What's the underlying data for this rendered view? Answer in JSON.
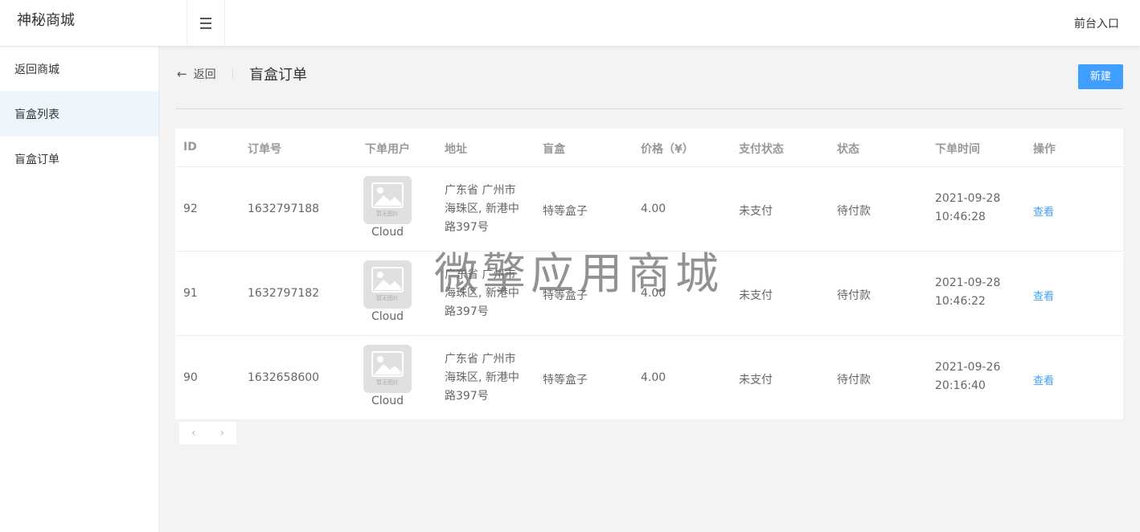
{
  "header": {
    "brand": "神秘商城",
    "front_entry": "前台入口"
  },
  "sidebar": {
    "items": [
      {
        "label": "返回商城"
      },
      {
        "label": "盲盒列表"
      },
      {
        "label": "盲盒订单"
      }
    ]
  },
  "page": {
    "back_label": "返回",
    "title": "盲盒订单",
    "new_button": "新建"
  },
  "table": {
    "columns": [
      "ID",
      "订单号",
      "下单用户",
      "地址",
      "盲盒",
      "价格（¥）",
      "支付状态",
      "状态",
      "下单时间",
      "操作"
    ],
    "rows": [
      {
        "id": "92",
        "order_no": "1632797188",
        "avatar_text": "暂无图片",
        "user": "Cloud",
        "address": "广东省 广州市 海珠区, 新港中路397号",
        "box": "特等盒子",
        "price": "4.00",
        "pay_status": "未支付",
        "status": "待付款",
        "time": "2021-09-28 10:46:28",
        "action": "查看"
      },
      {
        "id": "91",
        "order_no": "1632797182",
        "avatar_text": "暂无图片",
        "user": "Cloud",
        "address": "广东省 广州市 海珠区, 新港中路397号",
        "box": "特等盒子",
        "price": "4.00",
        "pay_status": "未支付",
        "status": "待付款",
        "time": "2021-09-28 10:46:22",
        "action": "查看"
      },
      {
        "id": "90",
        "order_no": "1632658600",
        "avatar_text": "暂无图片",
        "user": "Cloud",
        "address": "广东省 广州市 海珠区, 新港中路397号",
        "box": "特等盒子",
        "price": "4.00",
        "pay_status": "未支付",
        "status": "待付款",
        "time": "2021-09-26 20:16:40",
        "action": "查看"
      }
    ]
  },
  "pagination": {
    "prev": "‹",
    "next": "›"
  },
  "watermark": "微擎应用商城",
  "colors": {
    "accent": "#409eff",
    "active_bg": "#eef6fd"
  }
}
